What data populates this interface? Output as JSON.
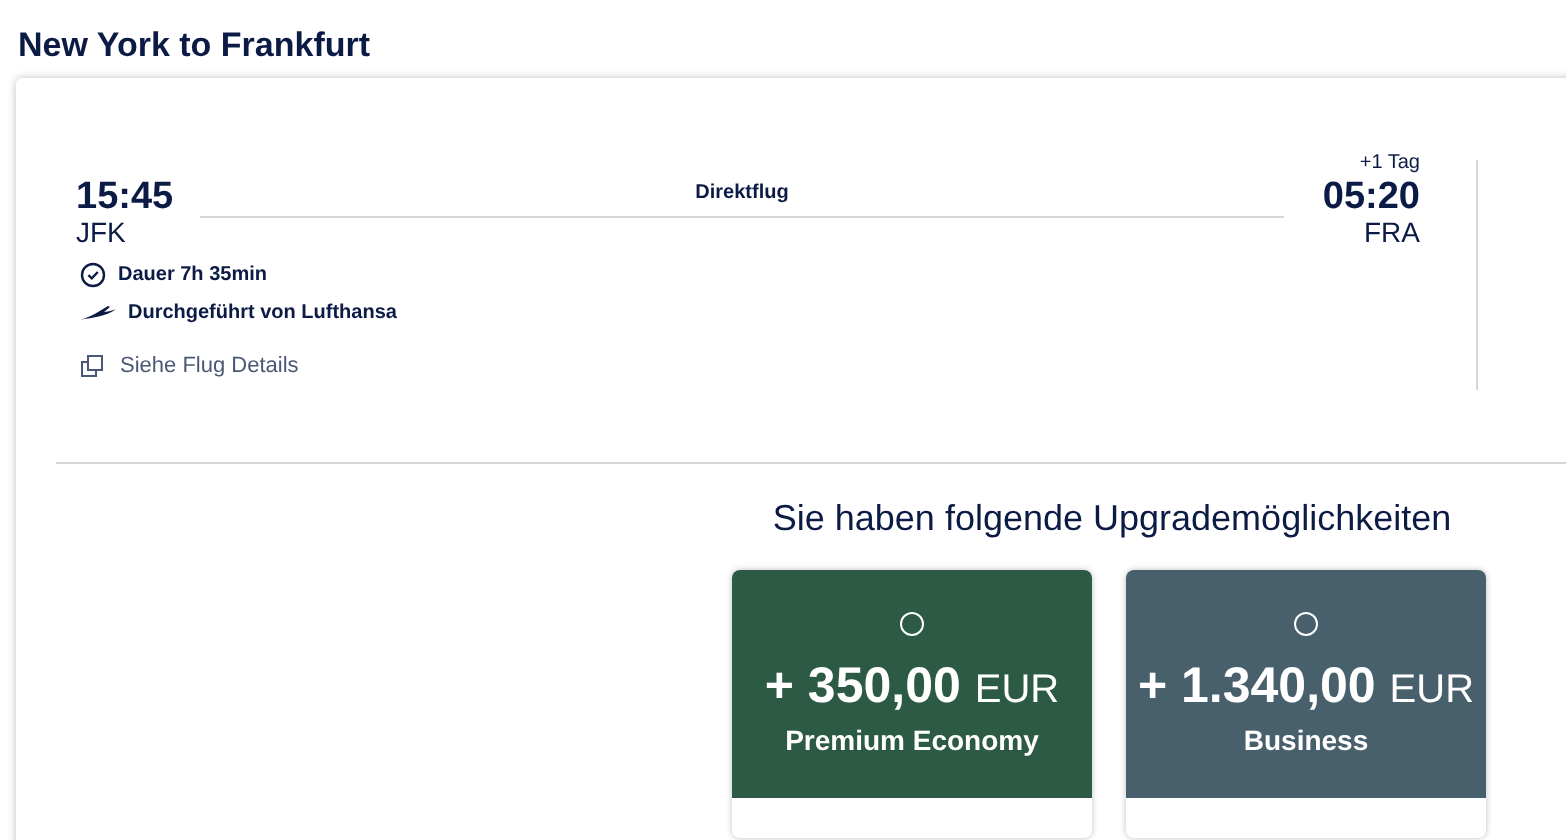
{
  "title": "New York to Frankfurt",
  "flight": {
    "departure_time": "15:45",
    "departure_airport": "JFK",
    "stops": "Direktflug",
    "day_offset": "+1 Tag",
    "arrival_time": "05:20",
    "arrival_airport": "FRA",
    "duration": "Dauer 7h 35min",
    "operator": "Durchgeführt von Lufthansa",
    "details_link": "Siehe Flug Details"
  },
  "upgrades": {
    "heading": "Sie haben folgende Upgrademöglichkeiten",
    "options": [
      {
        "price": "+ 350,00",
        "currency": "EUR",
        "cabin": "Premium Economy",
        "color": "#2d5a45",
        "selected": false
      },
      {
        "price": "+ 1.340,00",
        "currency": "EUR",
        "cabin": "Business",
        "color": "#485f6c",
        "selected": false
      }
    ]
  }
}
